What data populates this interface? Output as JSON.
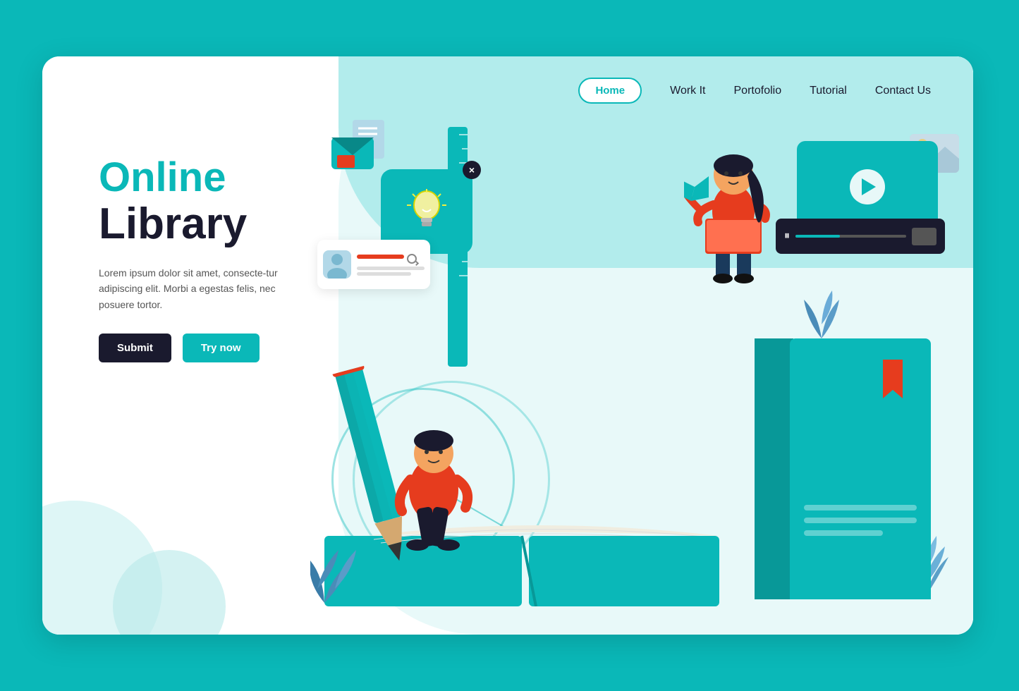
{
  "page": {
    "bg_color": "#0ab8b8"
  },
  "nav": {
    "home_label": "Home",
    "workit_label": "Work It",
    "portfolio_label": "Portofolio",
    "tutorial_label": "Tutorial",
    "contact_label": "Contact Us"
  },
  "hero": {
    "title_line1": "Online",
    "title_line2": "Library",
    "description": "Lorem ipsum dolor sit amet, consecte-tur adipiscing elit. Morbi a egestas felis, nec posuere tortor.",
    "btn_submit": "Submit",
    "btn_try": "Try now"
  },
  "video": {
    "progress_percent": 40
  },
  "colors": {
    "teal": "#0ab8b8",
    "dark": "#1a1a2e",
    "orange": "#e63c1e",
    "light_teal": "#e8f9f9"
  }
}
